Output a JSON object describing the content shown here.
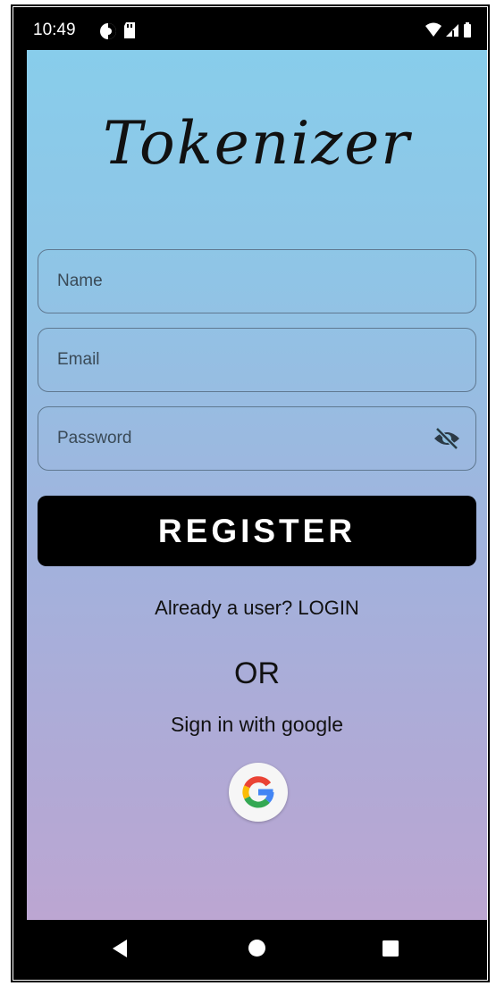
{
  "status_bar": {
    "time": "10:49",
    "icons": [
      "data-saver-icon",
      "sd-card-icon",
      "wifi-icon",
      "cellular-signal-icon",
      "battery-icon"
    ]
  },
  "app": {
    "title": "Tokenizer"
  },
  "form": {
    "name_placeholder": "Name",
    "email_placeholder": "Email",
    "password_placeholder": "Password",
    "register_label": "REGISTER"
  },
  "login_prompt": "Already a user? LOGIN",
  "divider_text": "OR",
  "google_prompt": "Sign in with google",
  "nav_bar": {
    "icons": [
      "back-icon",
      "home-icon",
      "recent-apps-icon"
    ]
  },
  "colors": {
    "gradient_top": "#88cdeb",
    "gradient_bottom": "#bca6d2",
    "button_bg": "#000000",
    "button_text": "#ffffff"
  }
}
